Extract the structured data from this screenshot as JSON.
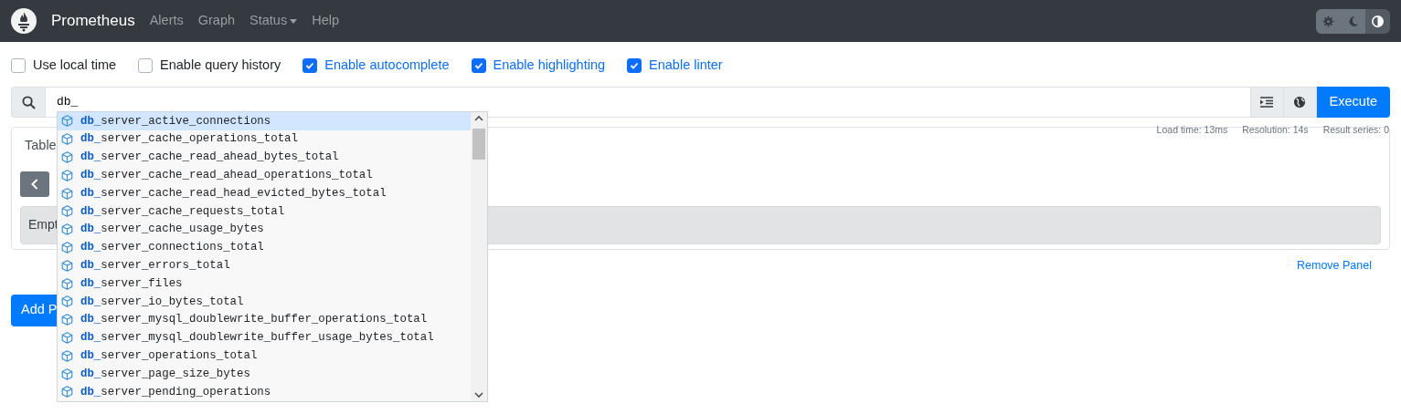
{
  "navbar": {
    "brand": "Prometheus",
    "links": [
      {
        "label": "Alerts",
        "dropdown": false
      },
      {
        "label": "Graph",
        "dropdown": false
      },
      {
        "label": "Status",
        "dropdown": true
      },
      {
        "label": "Help",
        "dropdown": false
      }
    ],
    "theme_buttons": [
      {
        "kind": "light",
        "selected": false
      },
      {
        "kind": "dark",
        "selected": false
      },
      {
        "kind": "auto",
        "selected": true
      }
    ]
  },
  "options": [
    {
      "label": "Use local time",
      "checked": false
    },
    {
      "label": "Enable query history",
      "checked": false
    },
    {
      "label": "Enable autocomplete",
      "checked": true
    },
    {
      "label": "Enable highlighting",
      "checked": true
    },
    {
      "label": "Enable linter",
      "checked": true
    }
  ],
  "query": {
    "value": "db_",
    "execute": "Execute"
  },
  "suggestions": [
    {
      "match": "db_",
      "rest": "server_active_connections",
      "selected": true
    },
    {
      "match": "db_",
      "rest": "server_cache_operations_total",
      "selected": false
    },
    {
      "match": "db_",
      "rest": "server_cache_read_ahead_bytes_total",
      "selected": false
    },
    {
      "match": "db_",
      "rest": "server_cache_read_ahead_operations_total",
      "selected": false
    },
    {
      "match": "db_",
      "rest": "server_cache_read_head_evicted_bytes_total",
      "selected": false
    },
    {
      "match": "db_",
      "rest": "server_cache_requests_total",
      "selected": false
    },
    {
      "match": "db_",
      "rest": "server_cache_usage_bytes",
      "selected": false
    },
    {
      "match": "db_",
      "rest": "server_connections_total",
      "selected": false
    },
    {
      "match": "db_",
      "rest": "server_errors_total",
      "selected": false
    },
    {
      "match": "db_",
      "rest": "server_files",
      "selected": false
    },
    {
      "match": "db_",
      "rest": "server_io_bytes_total",
      "selected": false
    },
    {
      "match": "db_",
      "rest": "server_mysql_doublewrite_buffer_operations_total",
      "selected": false
    },
    {
      "match": "db_",
      "rest": "server_mysql_doublewrite_buffer_usage_bytes_total",
      "selected": false
    },
    {
      "match": "db_",
      "rest": "server_operations_total",
      "selected": false
    },
    {
      "match": "db_",
      "rest": "server_page_size_bytes",
      "selected": false
    },
    {
      "match": "db_",
      "rest": "server_pending_operations",
      "selected": false
    }
  ],
  "panel": {
    "tab": "Table",
    "stats": [
      "Load time: 13ms",
      "Resolution: 14s",
      "Result series: 0"
    ],
    "alert": "Empt",
    "remove": "Remove Panel"
  },
  "add_panel": "Add P"
}
